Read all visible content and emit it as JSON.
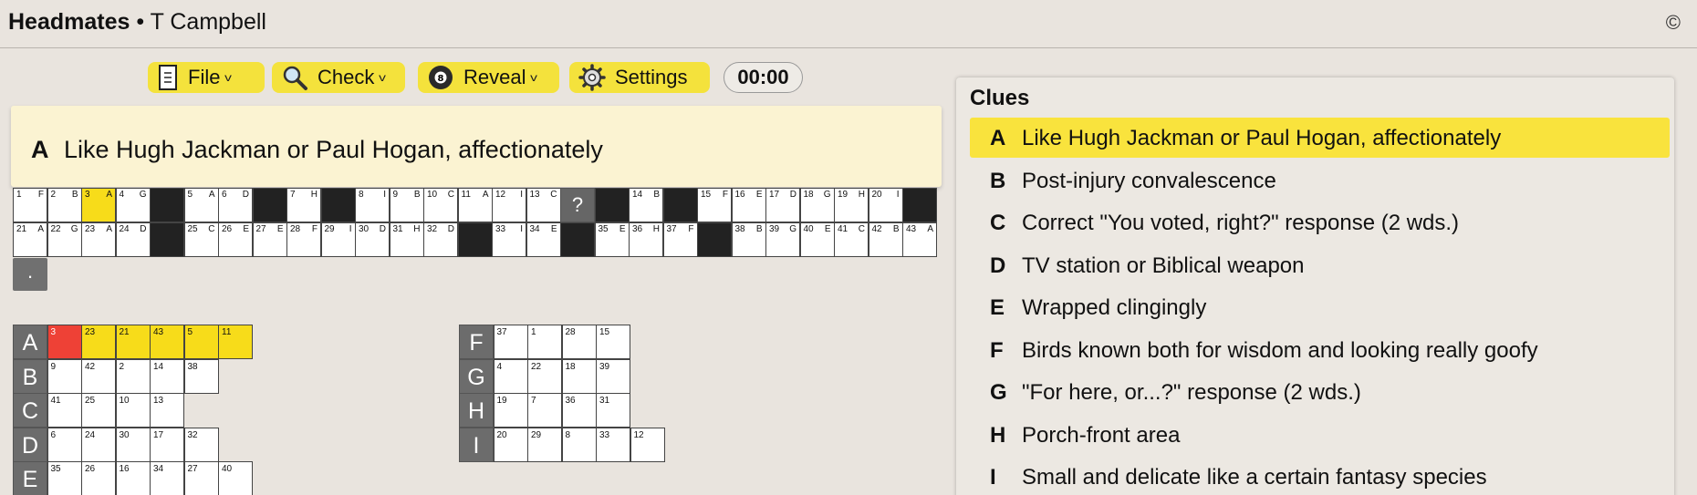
{
  "app": {
    "title": "Headmates",
    "separator": " • ",
    "author": "T Campbell",
    "copyright_symbol": "©"
  },
  "toolbar": {
    "file_label": "File",
    "check_label": "Check",
    "reveal_label": "Reveal",
    "settings_label": "Settings",
    "timer": "00:00"
  },
  "active_clue": {
    "letter": "A",
    "text": "Like Hugh Jackman or Paul Hogan, affectionately"
  },
  "quote_grid": {
    "rows": [
      [
        {
          "n": "1",
          "l": "F"
        },
        {
          "n": "2",
          "l": "B"
        },
        {
          "n": "3",
          "l": "A",
          "hl": true
        },
        {
          "n": "4",
          "l": "G"
        },
        {
          "black": true
        },
        {
          "n": "5",
          "l": "A"
        },
        {
          "n": "6",
          "l": "D"
        },
        {
          "black": true
        },
        {
          "n": "7",
          "l": "H"
        },
        {
          "black": true
        },
        {
          "n": "8",
          "l": "I"
        },
        {
          "n": "9",
          "l": "B"
        },
        {
          "n": "10",
          "l": "C"
        },
        {
          "n": "11",
          "l": "A"
        },
        {
          "n": "12",
          "l": "I"
        },
        {
          "n": "13",
          "l": "C"
        },
        {
          "q": "?"
        },
        {
          "black": true
        },
        {
          "n": "14",
          "l": "B"
        },
        {
          "black": true
        },
        {
          "n": "15",
          "l": "F"
        },
        {
          "n": "16",
          "l": "E"
        },
        {
          "n": "17",
          "l": "D"
        },
        {
          "n": "18",
          "l": "G"
        },
        {
          "n": "19",
          "l": "H"
        },
        {
          "n": "20",
          "l": "I"
        },
        {
          "black": true
        }
      ],
      [
        {
          "n": "21",
          "l": "A"
        },
        {
          "n": "22",
          "l": "G"
        },
        {
          "n": "23",
          "l": "A"
        },
        {
          "n": "24",
          "l": "D"
        },
        {
          "black": true
        },
        {
          "n": "25",
          "l": "C"
        },
        {
          "n": "26",
          "l": "E"
        },
        {
          "n": "27",
          "l": "E"
        },
        {
          "n": "28",
          "l": "F"
        },
        {
          "n": "29",
          "l": "I"
        },
        {
          "n": "30",
          "l": "D"
        },
        {
          "n": "31",
          "l": "H"
        },
        {
          "n": "32",
          "l": "D"
        },
        {
          "black": true
        },
        {
          "n": "33",
          "l": "I"
        },
        {
          "n": "34",
          "l": "E"
        },
        {
          "black": true
        },
        {
          "n": "35",
          "l": "E"
        },
        {
          "n": "36",
          "l": "H"
        },
        {
          "n": "37",
          "l": "F"
        },
        {
          "black": true
        },
        {
          "n": "38",
          "l": "B"
        },
        {
          "n": "39",
          "l": "G"
        },
        {
          "n": "40",
          "l": "E"
        },
        {
          "n": "41",
          "l": "C"
        },
        {
          "n": "42",
          "l": "B"
        },
        {
          "n": "43",
          "l": "A"
        }
      ]
    ],
    "punctuation": "."
  },
  "answer_rows_left": [
    {
      "letter": "A",
      "cells": [
        "3",
        "23",
        "21",
        "43",
        "5",
        "11"
      ],
      "current": 0,
      "highlight": true
    },
    {
      "letter": "B",
      "cells": [
        "9",
        "42",
        "2",
        "14",
        "38"
      ]
    },
    {
      "letter": "C",
      "cells": [
        "41",
        "25",
        "10",
        "13"
      ]
    },
    {
      "letter": "D",
      "cells": [
        "6",
        "24",
        "30",
        "17",
        "32"
      ]
    },
    {
      "letter": "E",
      "cells": [
        "35",
        "26",
        "16",
        "34",
        "27",
        "40"
      ]
    }
  ],
  "answer_rows_right": [
    {
      "letter": "F",
      "cells": [
        "37",
        "1",
        "28",
        "15"
      ]
    },
    {
      "letter": "G",
      "cells": [
        "4",
        "22",
        "18",
        "39"
      ]
    },
    {
      "letter": "H",
      "cells": [
        "19",
        "7",
        "36",
        "31"
      ]
    },
    {
      "letter": "I",
      "cells": [
        "20",
        "29",
        "8",
        "33",
        "12"
      ]
    }
  ],
  "clues": {
    "title": "Clues",
    "items": [
      {
        "letter": "A",
        "text": "Like Hugh Jackman or Paul Hogan, affectionately",
        "active": true
      },
      {
        "letter": "B",
        "text": "Post-injury convalescence"
      },
      {
        "letter": "C",
        "text": "Correct \"You voted, right?\" response (2 wds.)"
      },
      {
        "letter": "D",
        "text": "TV station or Biblical weapon"
      },
      {
        "letter": "E",
        "text": "Wrapped clingingly"
      },
      {
        "letter": "F",
        "text": "Birds known both for wisdom and looking really goofy"
      },
      {
        "letter": "G",
        "text": "\"For here, or...?\" response (2 wds.)"
      },
      {
        "letter": "H",
        "text": "Porch-front area"
      },
      {
        "letter": "I",
        "text": "Small and delicate like a certain fantasy species"
      }
    ]
  },
  "icons": {
    "file": "document-icon",
    "check": "magnifier-icon",
    "reveal": "eight-ball-icon",
    "settings": "gear-icon"
  },
  "colors": {
    "background": "#e9e4de",
    "button": "#f4e23c",
    "highlight": "#f7dc1a",
    "current_cell": "#ee4136",
    "banner": "#fbf3d2"
  }
}
